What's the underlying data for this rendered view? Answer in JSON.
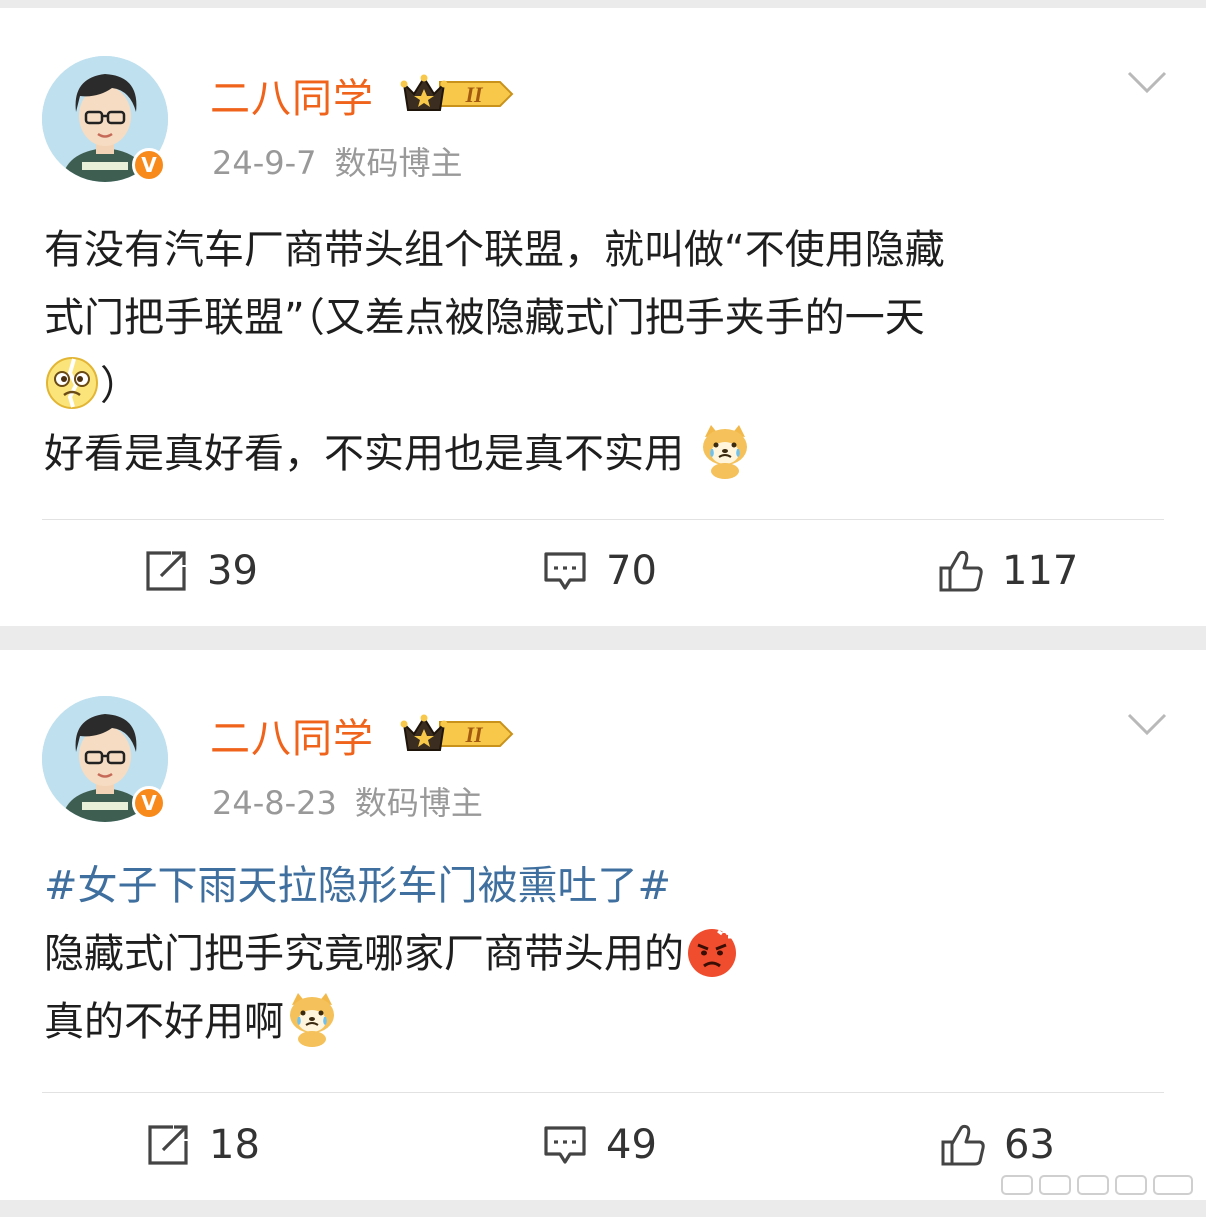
{
  "posts": [
    {
      "username": "二八同学",
      "badge_level": "II",
      "date": "24-9-7",
      "source": "数码博主",
      "content_lines": [
        "有没有汽车厂商带头组个联盟，就叫做“不使用隐藏",
        "式门把手联盟”（又差点被隐藏式门把手夹手的一天",
        "）",
        "好看是真好看，不实用也是真不实用"
      ],
      "emojis": [
        "dizzy-face-emoji",
        "crying-shiba-emoji"
      ],
      "actions": {
        "repost": "39",
        "comment": "70",
        "like": "117"
      }
    },
    {
      "username": "二八同学",
      "badge_level": "II",
      "date": "24-8-23",
      "source": "数码博主",
      "topic": "#女子下雨天拉隐形车门被熏吐了#",
      "content_lines": [
        "隐藏式门把手究竟哪家厂商带头用的",
        "真的不好用啊"
      ],
      "emojis": [
        "angry-face-emoji",
        "crying-shiba-emoji"
      ],
      "actions": {
        "repost": "18",
        "comment": "49",
        "like": "63"
      }
    }
  ],
  "colors": {
    "username": "#f0631b",
    "topic": "#3f6f9f",
    "meta": "#999999",
    "background": "#ebebeb"
  },
  "icons": [
    "avatar",
    "verified-v-icon",
    "crown-level-badge-icon",
    "chevron-down-icon",
    "repost-icon",
    "comment-icon",
    "like-icon"
  ]
}
